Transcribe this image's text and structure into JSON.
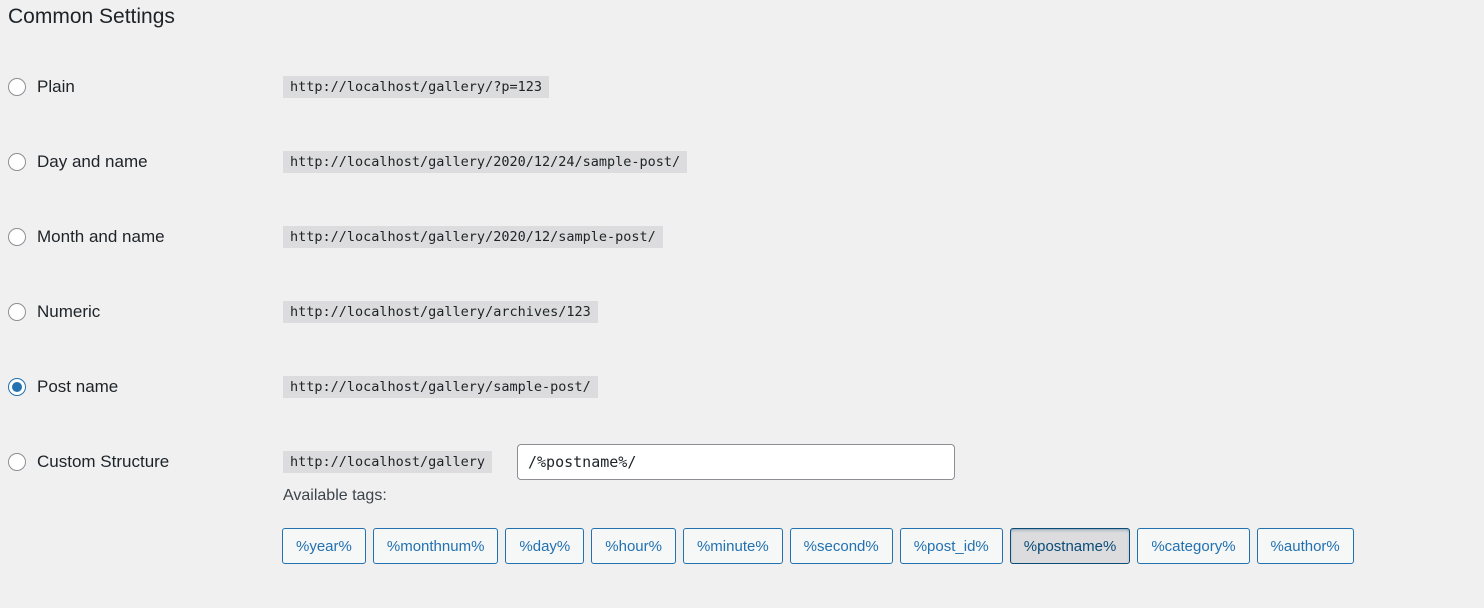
{
  "section_title": "Common Settings",
  "options": [
    {
      "label": "Plain",
      "example": "http://localhost/gallery/?p=123",
      "checked": false
    },
    {
      "label": "Day and name",
      "example": "http://localhost/gallery/2020/12/24/sample-post/",
      "checked": false
    },
    {
      "label": "Month and name",
      "example": "http://localhost/gallery/2020/12/sample-post/",
      "checked": false
    },
    {
      "label": "Numeric",
      "example": "http://localhost/gallery/archives/123",
      "checked": false
    },
    {
      "label": "Post name",
      "example": "http://localhost/gallery/sample-post/",
      "checked": true
    },
    {
      "label": "Custom Structure",
      "example": "http://localhost/gallery",
      "checked": false
    }
  ],
  "custom_structure": {
    "value": "/%postname%/"
  },
  "available_tags": {
    "label": "Available tags:",
    "tags": [
      "%year%",
      "%monthnum%",
      "%day%",
      "%hour%",
      "%minute%",
      "%second%",
      "%post_id%",
      "%postname%",
      "%category%",
      "%author%"
    ],
    "active_tag": "%postname%"
  },
  "colors": {
    "background": "#f0f0f1",
    "accent": "#2271b1",
    "code_background": "#dcdcde"
  }
}
